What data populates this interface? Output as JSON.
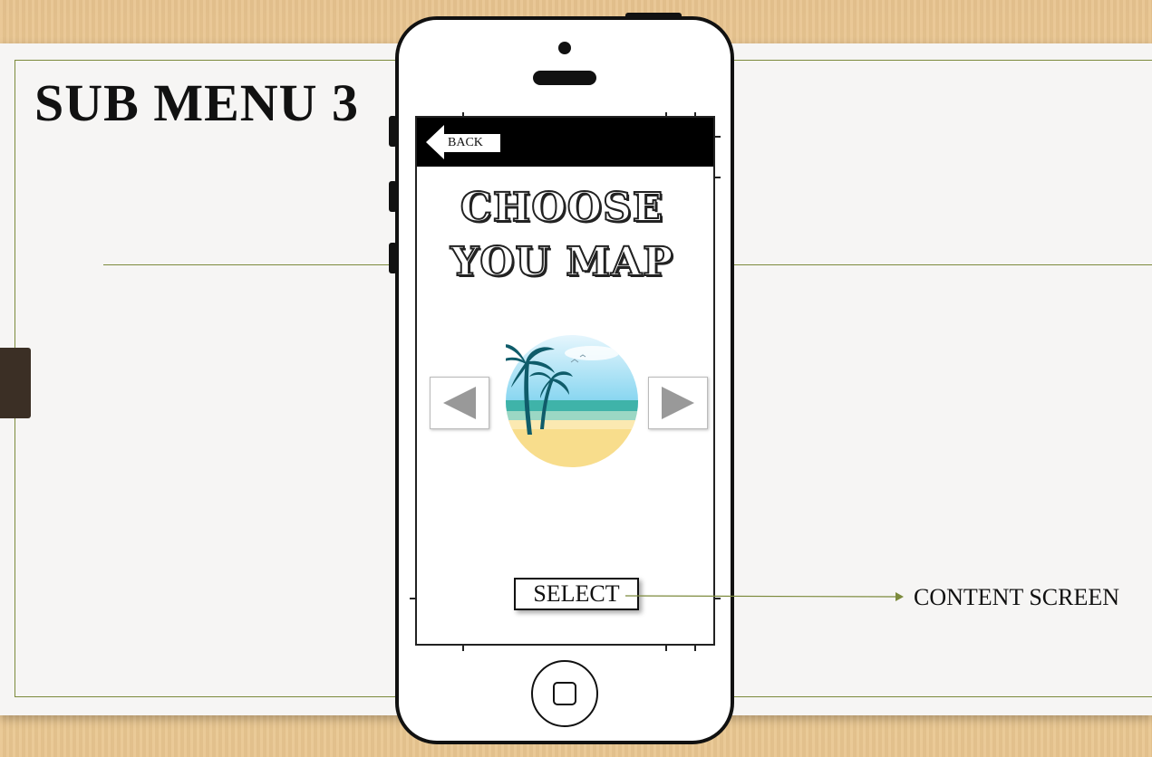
{
  "slide": {
    "title": "SUB MENU 3",
    "annotation_label": "CONTENT SCREEN"
  },
  "phone_screen": {
    "back_label": "BACK",
    "heading_line1": "CHOOSE",
    "heading_line2": "YOU MAP",
    "select_label": "SELECT",
    "map_image": "beach-palm-trees-icon",
    "prev_icon": "left-arrow-icon",
    "next_icon": "right-arrow-icon"
  },
  "colors": {
    "accent_line": "#7c8a3c",
    "topbar": "#000000",
    "paper": "#f6f5f4"
  }
}
